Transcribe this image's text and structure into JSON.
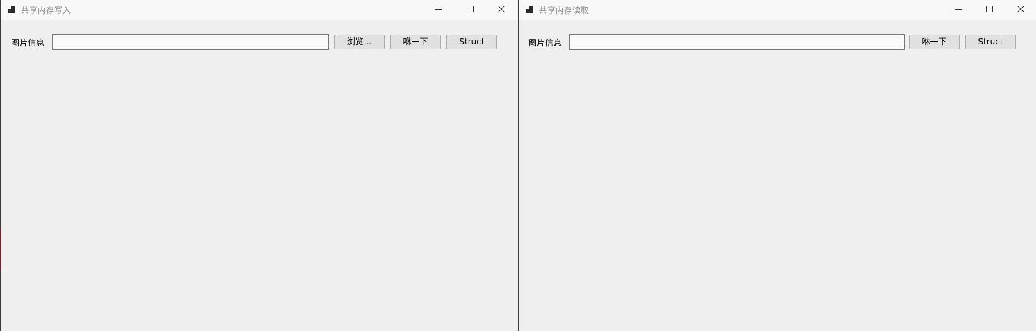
{
  "windows": {
    "writer": {
      "title": "共享内存写入",
      "label": "图片信息",
      "input_value": "",
      "buttons": {
        "browse": "浏览...",
        "sniff": "咻一下",
        "struct": "Struct"
      }
    },
    "reader": {
      "title": "共享内存读取",
      "label": "图片信息",
      "input_value": "",
      "buttons": {
        "sniff": "咻一下",
        "struct": "Struct"
      }
    }
  },
  "icons": {
    "app": "app-window-icon",
    "minimize": "minimize-icon",
    "maximize": "maximize-icon",
    "close": "close-icon"
  },
  "colors": {
    "titlebar": "#f8f8f8",
    "client": "#efefef",
    "title_text": "#8a8a8a",
    "button_face": "#e1e1e1",
    "button_border": "#adadad"
  }
}
